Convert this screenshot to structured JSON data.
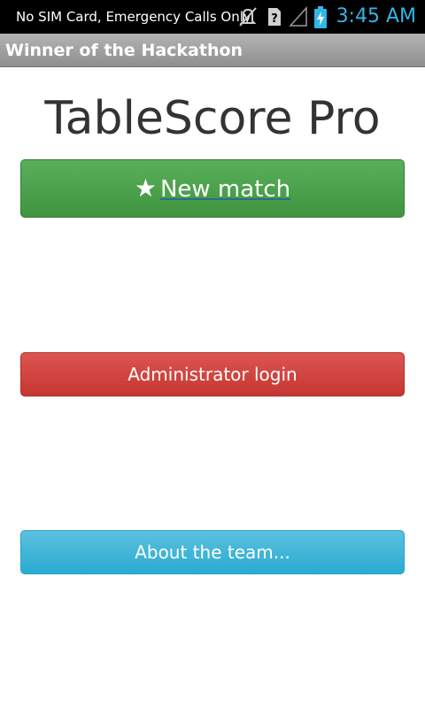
{
  "status_bar": {
    "carrier_text": "No SIM Card, Emergency Calls Only",
    "time": "3:45 AM",
    "icons": [
      "muted-notification-icon",
      "no-sim-icon",
      "no-signal-icon",
      "battery-charging-icon"
    ],
    "accent_color": "#33b5e5"
  },
  "action_bar": {
    "title": "Winner of the Hackathon"
  },
  "main": {
    "app_title": "TableScore Pro",
    "new_match_icon": "★",
    "new_match_label": "New match",
    "admin_login_label": "Administrator login",
    "about_team_label": "About the team..."
  },
  "colors": {
    "success": "#47a447",
    "danger": "#d2322d",
    "info": "#39b3d7"
  }
}
